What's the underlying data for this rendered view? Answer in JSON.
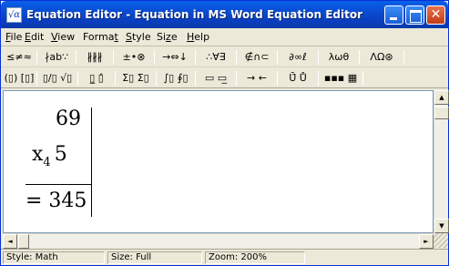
{
  "window": {
    "title": "Equation Editor - Equation in MS Word Equation Editor Quick ...",
    "app_icon": "√α",
    "minimize_icon": "minimize-icon",
    "maximize_icon": "maximize-icon",
    "close_glyph": "✕"
  },
  "menu": [
    {
      "key": "F",
      "rest": "ile"
    },
    {
      "key": "E",
      "rest": "dit"
    },
    {
      "key": "V",
      "rest": "iew"
    },
    {
      "pre": "Forma",
      "key": "t",
      "rest": ""
    },
    {
      "key": "S",
      "rest": "tyle"
    },
    {
      "pre": "Si",
      "key": "z",
      "rest": "e"
    },
    {
      "key": "H",
      "rest": "elp"
    }
  ],
  "toolbar_row1": [
    "≤≠≈",
    "∤ab∵",
    "∦∦∦",
    "±•⊗",
    "→⇔↓",
    "∴∀∃",
    "∉∩⊂",
    "∂∞ℓ",
    "λωθ",
    "ΛΩ⊛"
  ],
  "toolbar_row2": [
    "(▯) [▯]",
    "▯/▯ √▯",
    "▯̲ ▯̂",
    "Σ▯ Σ▯",
    "∫▯ ∮▯",
    "▭ ▭̲",
    "→ ←",
    "Ū̃ Ů",
    "▪▪▪ ▦"
  ],
  "document": {
    "line1": "69",
    "line2_var": "x",
    "line2_sub": "4",
    "line2_num": "5",
    "line3": "= 345"
  },
  "scroll": {
    "up": "▲",
    "down": "▼",
    "left": "◄",
    "right": "►"
  },
  "status": {
    "style": "Style: Math",
    "size": "Size: Full",
    "zoom": "Zoom: 200%"
  }
}
